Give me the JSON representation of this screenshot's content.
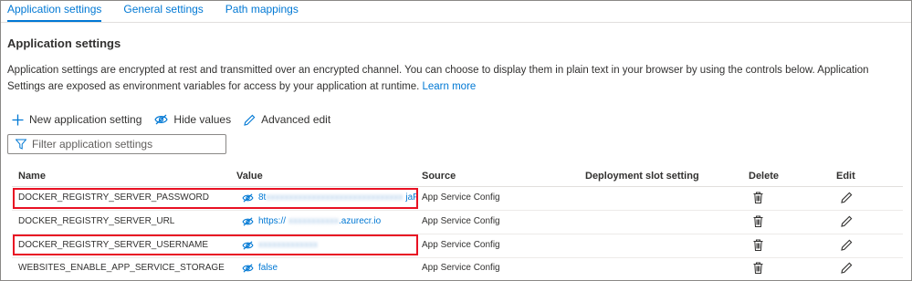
{
  "tabs": [
    {
      "label": "Application settings",
      "active": true
    },
    {
      "label": "General settings",
      "active": false
    },
    {
      "label": "Path mappings",
      "active": false
    }
  ],
  "section": {
    "title": "Application settings",
    "description": "Application settings are encrypted at rest and transmitted over an encrypted channel. You can choose to display them in plain text in your browser by using the controls below. Application Settings are exposed as environment variables for access by your application at runtime.",
    "learn_more": "Learn more"
  },
  "toolbar": {
    "new_setting": "New application setting",
    "hide_values": "Hide values",
    "advanced_edit": "Advanced edit"
  },
  "filter": {
    "placeholder": "Filter application settings"
  },
  "table": {
    "headers": {
      "name": "Name",
      "value": "Value",
      "source": "Source",
      "slot": "Deployment slot setting",
      "delete": "Delete",
      "edit": "Edit"
    },
    "rows": [
      {
        "name": "DOCKER_REGISTRY_SERVER_PASSWORD",
        "value_visible": "8t",
        "value_redacted": "xxxxxxxxxxxxxxxxxxxxxxxxxxxxxx",
        "value_suffix": "jaF",
        "source": "App Service Config",
        "highlighted": true
      },
      {
        "name": "DOCKER_REGISTRY_SERVER_URL",
        "value_visible": "https://",
        "value_redacted": "xxxxxxxxxxx",
        "value_suffix": ".azurecr.io",
        "source": "App Service Config",
        "highlighted": false
      },
      {
        "name": "DOCKER_REGISTRY_SERVER_USERNAME",
        "value_visible": "",
        "value_redacted": "xxxxxxxxxxxxx",
        "value_suffix": "",
        "source": "App Service Config",
        "highlighted": true
      },
      {
        "name": "WEBSITES_ENABLE_APP_SERVICE_STORAGE",
        "value_visible": "false",
        "value_redacted": "",
        "value_suffix": "",
        "source": "App Service Config",
        "highlighted": false
      }
    ]
  },
  "colors": {
    "accent": "#0078d4",
    "highlight_border": "#e81123"
  }
}
